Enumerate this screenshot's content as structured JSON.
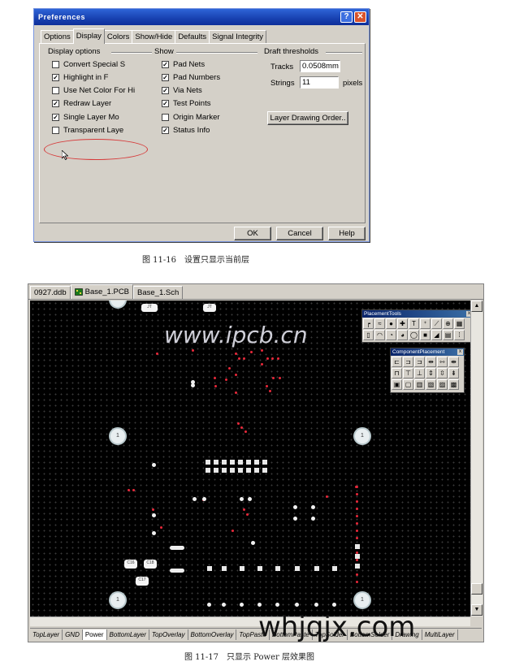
{
  "dialog": {
    "title": "Preferences",
    "help_btn": "?",
    "close_btn": "✕",
    "tabs": [
      "Options",
      "Display",
      "Colors",
      "Show/Hide",
      "Defaults",
      "Signal Integrity"
    ],
    "display_options": {
      "title": "Display options",
      "items": [
        {
          "label": "Convert Special S",
          "checked": false
        },
        {
          "label": "Highlight in F",
          "checked": true
        },
        {
          "label": "Use Net Color For Hi",
          "checked": false
        },
        {
          "label": "Redraw Layer",
          "checked": true
        },
        {
          "label": "Single Layer Mo",
          "checked": true
        },
        {
          "label": "Transparent Laye",
          "checked": false
        }
      ]
    },
    "show": {
      "title": "Show",
      "items": [
        {
          "label": "Pad Nets",
          "checked": true
        },
        {
          "label": "Pad Numbers",
          "checked": true
        },
        {
          "label": "Via Nets",
          "checked": true
        },
        {
          "label": "Test Points",
          "checked": true
        },
        {
          "label": "Origin Marker",
          "checked": false
        },
        {
          "label": "Status Info",
          "checked": true
        }
      ]
    },
    "draft": {
      "title": "Draft thresholds",
      "tracks_label": "Tracks",
      "tracks_value": "0.0508mm",
      "strings_label": "Strings",
      "strings_value": "11",
      "strings_unit": "pixels"
    },
    "layer_order_btn": "Layer Drawing Order..",
    "ok": "OK",
    "cancel": "Cancel",
    "help": "Help"
  },
  "caption1": "图 11-16　设置只显示当前层",
  "pcb": {
    "doc_tabs": [
      "0927.ddb",
      "Base_1.PCB",
      "Base_1.Sch"
    ],
    "layer_tabs": [
      "TopLayer",
      "GND",
      "Power",
      "BottomLayer",
      "TopOverlay",
      "BottomOverlay",
      "TopPaste",
      "BottomPaste",
      "TopSolder",
      "BottomSolder",
      "Drawing",
      "MultiLayer"
    ],
    "active_layer": "Power",
    "mount_label": "1",
    "placement_tools_title": "PlacementTools",
    "component_placement_title": "ComponentPlacement",
    "comp_labels": [
      "C16",
      "C18",
      "C17"
    ],
    "top_labels": [
      "JT",
      "JT"
    ]
  },
  "caption2": "图 11-17　只显示 Power 层效果图",
  "watermarks": {
    "wm1": "www.ipcb.cn",
    "wm2": "whjqjx.com"
  },
  "colors": {
    "titlebar": "#1840b0",
    "pcb_bg": "#000000",
    "pad_red": "#e8283a",
    "highlight_circle": "#d63a3a"
  }
}
